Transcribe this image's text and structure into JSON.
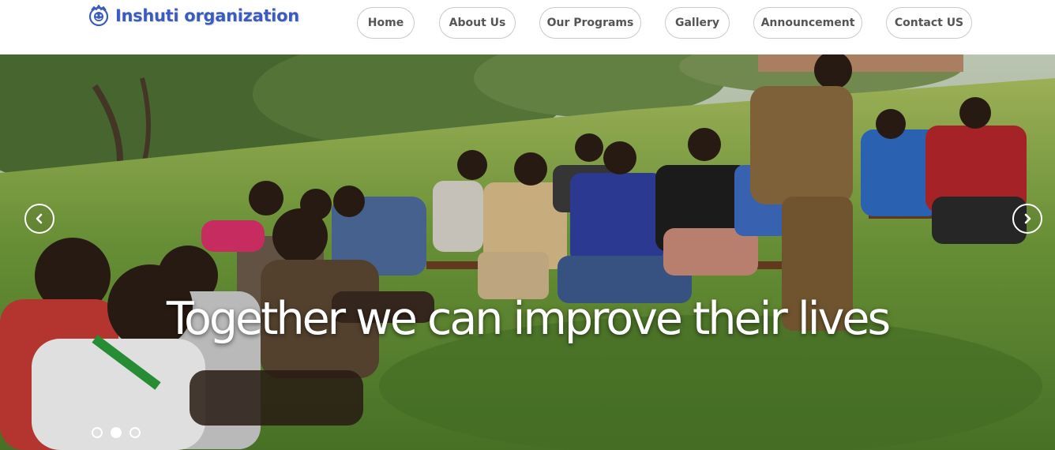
{
  "brand": {
    "name": "Inshuti organization",
    "logo_icon": "org-emblem-icon",
    "color": "#3a5bbf"
  },
  "nav": {
    "home": "Home",
    "about": "About Us",
    "programs": "Our Programs",
    "gallery": "Gallery",
    "announcement": "Announcement",
    "contact": "Contact US"
  },
  "hero": {
    "caption": "Together we can improve their lives",
    "prev_icon": "chevron-left-icon",
    "next_icon": "chevron-right-icon",
    "slide_count": 3,
    "active_slide": 2
  }
}
